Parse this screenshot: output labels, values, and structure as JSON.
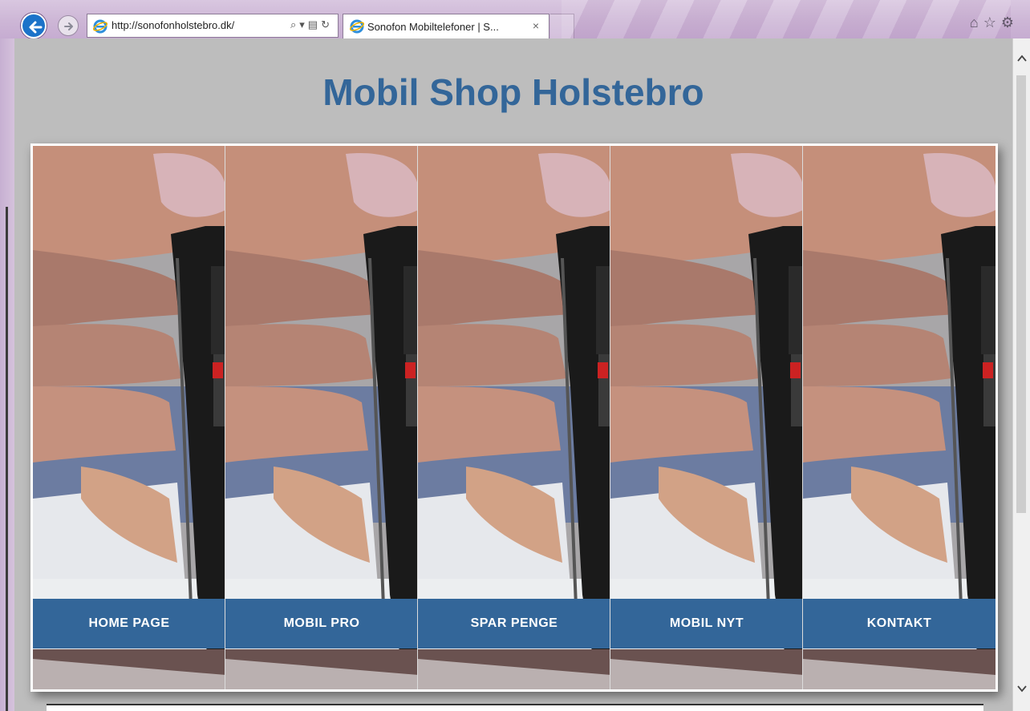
{
  "browser": {
    "address_url": "http://sonofonholstebro.dk/",
    "tab_title": "Sonofon Mobiltelefoner | S...",
    "tab_close": "×",
    "address_tools": [
      "⌕",
      "▾",
      "▤",
      "↻"
    ],
    "right_icons": [
      "⌂",
      "☆",
      "⚙"
    ]
  },
  "page": {
    "title": "Mobil Shop Holstebro",
    "menu": [
      {
        "label": "HOME PAGE"
      },
      {
        "label": "MOBIL PRO"
      },
      {
        "label": "SPAR PENGE"
      },
      {
        "label": "MOBIL NYT"
      },
      {
        "label": "KONTAKT"
      }
    ]
  },
  "colors": {
    "accent": "#336699",
    "page_background": "#bdbdbd"
  },
  "icons": [
    "back-arrow-icon",
    "forward-arrow-icon",
    "ie-logo-icon",
    "home-icon",
    "favorites-star-icon",
    "settings-gear-icon"
  ]
}
